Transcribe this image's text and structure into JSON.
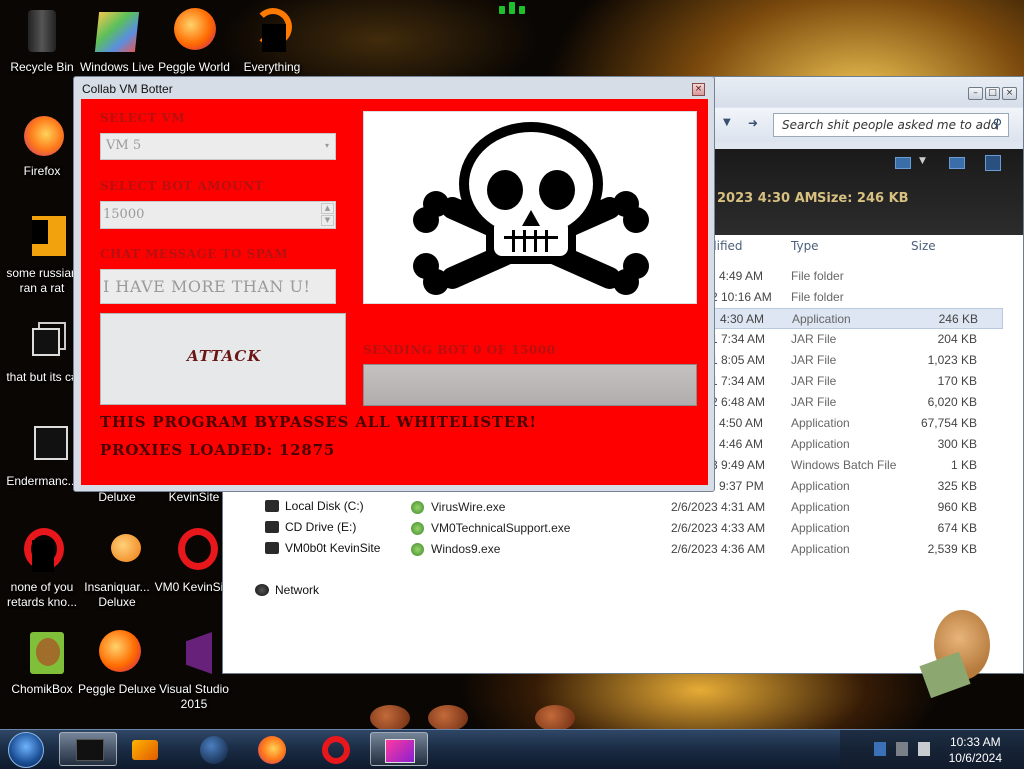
{
  "desktop_icons": [
    {
      "label": "Recycle Bin",
      "name": "recycle-bin"
    },
    {
      "label": "Windows Live",
      "name": "windows-live"
    },
    {
      "label": "Peggle World",
      "name": "peggle-world"
    },
    {
      "label": "Everything",
      "name": "everything"
    },
    {
      "label": "Firefox",
      "name": "firefox"
    },
    {
      "label": "some russian ran a rat",
      "name": "russian-rat"
    },
    {
      "label": "that but its c#",
      "name": "that-but-c"
    },
    {
      "label": "Endermanc...",
      "name": "endermanc"
    },
    {
      "label": "Deluxe",
      "name": "deluxe-1"
    },
    {
      "label": "KevinSite",
      "name": "kevinsite-1"
    },
    {
      "label": "none of you retards kno...",
      "name": "none-of-you"
    },
    {
      "label": "Insaniquar... Deluxe",
      "name": "insaniquarium"
    },
    {
      "label": "VM0 KevinSi...",
      "name": "vm0-kevinsite"
    },
    {
      "label": "ChomikBox",
      "name": "chomikbox"
    },
    {
      "label": "Peggle Deluxe",
      "name": "peggle-deluxe"
    },
    {
      "label": "Visual Studio 2015",
      "name": "visual-studio"
    }
  ],
  "explorer": {
    "search_placeholder": "Search shit people asked me to add",
    "details_date": "2023 4:30 AM",
    "details_size": "Size: 246 KB",
    "columns": {
      "modified": "dified",
      "type": "Type",
      "size": "Size"
    },
    "rows": [
      {
        "name": "",
        "date": "4:49 AM",
        "type": "File folder",
        "size": ""
      },
      {
        "name": "",
        "date": "2 10:16 AM",
        "type": "File folder",
        "size": ""
      },
      {
        "name": "",
        "date": "4:30 AM",
        "type": "Application",
        "size": "246 KB"
      },
      {
        "name": "",
        "date": "1 7:34 AM",
        "type": "JAR File",
        "size": "204 KB"
      },
      {
        "name": "",
        "date": "1 8:05 AM",
        "type": "JAR File",
        "size": "1,023 KB"
      },
      {
        "name": "",
        "date": "1 7:34 AM",
        "type": "JAR File",
        "size": "170 KB"
      },
      {
        "name": "",
        "date": "2 6:48 AM",
        "type": "JAR File",
        "size": "6,020 KB"
      },
      {
        "name": "",
        "date": "4:50 AM",
        "type": "Application",
        "size": "67,754 KB"
      },
      {
        "name": "",
        "date": "4:46 AM",
        "type": "Application",
        "size": "300 KB"
      },
      {
        "name": "",
        "date": "3 9:49 AM",
        "type": "Windows Batch File",
        "size": "1 KB"
      },
      {
        "name": "",
        "date": "9:37 PM",
        "type": "Application",
        "size": "325 KB"
      },
      {
        "name": "VirusWire.exe",
        "date": "2/6/2023 4:31 AM",
        "type": "Application",
        "size": "960 KB"
      },
      {
        "name": "VM0TechnicalSupport.exe",
        "date": "2/6/2023 4:33 AM",
        "type": "Application",
        "size": "674 KB"
      },
      {
        "name": "Windos9.exe",
        "date": "2/6/2023 4:36 AM",
        "type": "Application",
        "size": "2,539 KB"
      }
    ],
    "nav_items": [
      "Local Disk (C:)",
      "CD Drive (E:)",
      "VM0b0t KevinSite",
      "Network"
    ]
  },
  "botter": {
    "title": "Collab VM Botter",
    "select_vm_label": "SELECT VM",
    "select_vm_value": "VM 5",
    "bot_amount_label": "SELECT BOT AMOUNT",
    "bot_amount_value": "15000",
    "chat_label": "CHAT MESSAGE TO SPAM",
    "chat_value": "I HAVE MORE THAN U!",
    "attack_label": "ATTACK",
    "sending_status": "SENDING BOT 0 OF 15000",
    "progress": 0,
    "bypass_text": "THIS PROGRAM BYPASSES ALL WHITELISTER!",
    "proxies_text": "PROXIES LOADED: 12875"
  },
  "taskbar": {
    "time": "10:33 AM",
    "date": "10/6/2024"
  }
}
